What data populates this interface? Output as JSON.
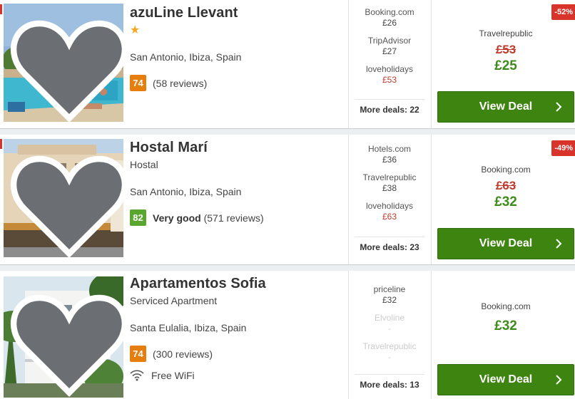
{
  "hotels": [
    {
      "name": "azuLine Llevant",
      "stars": "★",
      "location": "San Antonio, Ibiza, Spain",
      "score": "74",
      "rating_word": "",
      "reviews": "(58 reviews)",
      "deals": [
        {
          "provider": "Booking.com",
          "price": "£26"
        },
        {
          "provider": "TripAdvisor",
          "price": "£27"
        },
        {
          "provider": "loveholidays",
          "price": "£53"
        }
      ],
      "more_deals": "More deals: 22",
      "best_provider": "Travelrepublic",
      "old_price": "£53",
      "new_price": "£25",
      "discount": "-52%",
      "cta": "View Deal"
    },
    {
      "name": "Hostal Marí",
      "subtype": "Hostal",
      "location": "San Antonio, Ibiza, Spain",
      "score": "82",
      "rating_word": "Very good",
      "reviews": "(571 reviews)",
      "deals": [
        {
          "provider": "Hotels.com",
          "price": "£36"
        },
        {
          "provider": "Travelrepublic",
          "price": "£38"
        },
        {
          "provider": "loveholidays",
          "price": "£63"
        }
      ],
      "more_deals": "More deals: 23",
      "best_provider": "Booking.com",
      "old_price": "£63",
      "new_price": "£32",
      "discount": "-49%",
      "cta": "View Deal"
    },
    {
      "name": "Apartamentos Sofia",
      "subtype": "Serviced Apartment",
      "location": "Santa Eulalia, Ibiza, Spain",
      "score": "74",
      "rating_word": "",
      "reviews": "(300 reviews)",
      "amenity": "Free WiFi",
      "deals": [
        {
          "provider": "priceline",
          "price": "£32"
        },
        {
          "provider": "Elvoline",
          "price": "-"
        },
        {
          "provider": "Travelrepublic",
          "price": "-"
        }
      ],
      "more_deals": "More deals: 13",
      "best_provider": "Booking.com",
      "new_price": "£32",
      "cta": "View Deal"
    }
  ],
  "colors": {
    "score_orange": "#e67e0e",
    "score_green": "#5aa72f",
    "cta_green": "#3d8410",
    "price_green": "#3d8b1a",
    "strike_red": "#c0392b",
    "badge_red": "#d9342b"
  },
  "icons": {
    "favorite": "heart-icon",
    "rating_star": "star-icon",
    "wifi": "wifi-icon",
    "cta_arrow": "chevron-right-icon"
  }
}
